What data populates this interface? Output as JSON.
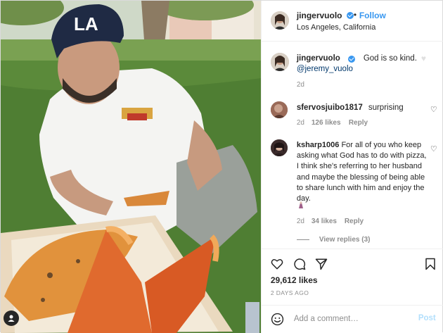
{
  "header": {
    "username": "jingervuolo",
    "separator": "•",
    "follow_label": "Follow",
    "location": "Los Angeles, California"
  },
  "caption": {
    "username": "jingervuolo",
    "text": "God is so kind.",
    "mention": "@jeremy_vuolo",
    "time": "2d"
  },
  "comments": [
    {
      "username": "sfervosjuibo1817",
      "text": "surprising",
      "time": "2d",
      "likes": "126 likes",
      "reply_label": "Reply"
    },
    {
      "username": "ksharp1006",
      "text": "For all of you who keep asking what God has to do with pizza, I think she's referring to her husband and maybe the blessing of being able to share lunch with him and enjoy the day.",
      "time": "2d",
      "likes": "34 likes",
      "reply_label": "Reply",
      "view_replies": "View replies (3)"
    }
  ],
  "actions": {
    "icons": [
      "heart-icon",
      "comment-icon",
      "share-icon",
      "bookmark-icon"
    ],
    "likes": "29,612 likes",
    "date": "2 DAYS AGO"
  },
  "add_comment": {
    "placeholder": "Add a comment…",
    "post_label": "Post"
  },
  "colors": {
    "link_blue": "#3897f0",
    "mention_blue": "#00376b",
    "muted_gray": "#8e8e8e",
    "post_disabled": "#b2dffc",
    "text": "#262626"
  }
}
